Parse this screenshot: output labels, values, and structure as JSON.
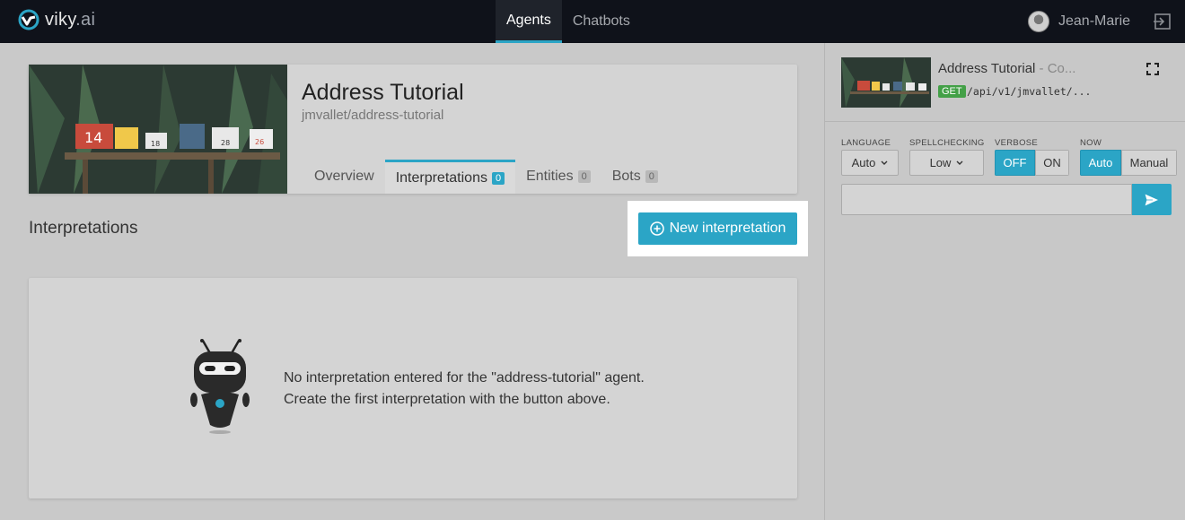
{
  "brand": {
    "name": "viky",
    "suffix": ".ai"
  },
  "nav": {
    "agents": "Agents",
    "chatbots": "Chatbots"
  },
  "user": {
    "name": "Jean-Marie"
  },
  "agent": {
    "title": "Address Tutorial",
    "slug": "jmvallet/address-tutorial",
    "tabs": [
      {
        "label": "Overview"
      },
      {
        "label": "Interpretations",
        "count": "0"
      },
      {
        "label": "Entities",
        "count": "0"
      },
      {
        "label": "Bots",
        "count": "0"
      }
    ],
    "mailbox_numbers": [
      "14",
      "18",
      "28",
      "26"
    ]
  },
  "section": {
    "title": "Interpretations"
  },
  "new_button": {
    "label": "New interpretation"
  },
  "empty": {
    "line1": "No interpretation entered for the \"address-tutorial\" agent.",
    "line2": "Create the first interpretation with the button above."
  },
  "console": {
    "title": "Address Tutorial",
    "title_suffix": " - Co...",
    "method": "GET",
    "path": "/api/v1/jmvallet/...",
    "language": {
      "label": "LANGUAGE",
      "value": "Auto"
    },
    "spellchecking": {
      "label": "SPELLCHECKING",
      "value": "Low"
    },
    "verbose": {
      "label": "VERBOSE",
      "off": "OFF",
      "on": "ON",
      "selected": "OFF"
    },
    "now": {
      "label": "NOW",
      "auto": "Auto",
      "manual": "Manual",
      "selected": "Auto"
    },
    "input_placeholder": ""
  },
  "colors": {
    "accent": "#2ba5c6",
    "topbar": "#0f121a",
    "get_badge": "#43a047"
  }
}
